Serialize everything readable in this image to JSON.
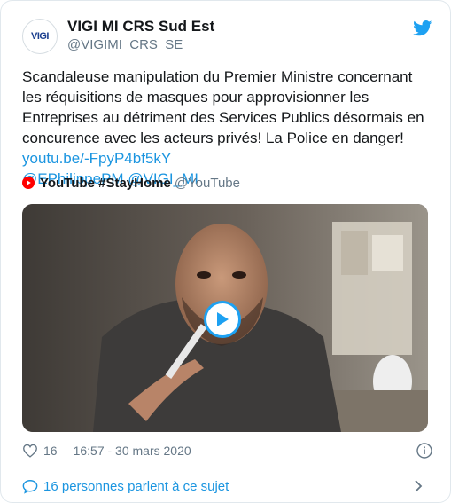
{
  "tweet": {
    "author_name": "VIGI MI CRS Sud Est",
    "author_handle": "@VIGIMI_CRS_SE",
    "avatar_text": "VIGI",
    "text": "Scandaleuse manipulation du Premier Ministre concernant les réquisitions de masques pour approvisionner les Entreprises au détriment des Services Publics désormais en concurence avec les acteurs privés! La Police en danger! ",
    "link": "youtu.be/-FpyP4bf5kY",
    "mentions": [
      "@EPhilippePM",
      "@VIGI_MI"
    ],
    "likes": "16",
    "timestamp": "16:57 - 30 mars 2020",
    "conversation": "16 personnes parlent à ce sujet"
  },
  "source": {
    "title": "YouTube #StayHome",
    "handle": "@YouTube"
  },
  "icons": {
    "platform": "twitter-bird-icon",
    "source": "youtube-icon",
    "play": "play-icon",
    "like": "heart-icon",
    "info": "info-icon",
    "conversation": "speech-bubble-icon",
    "more": "chevron-right-icon"
  },
  "colors": {
    "link": "#1b95e0",
    "text": "#14171a",
    "muted": "#657786",
    "twitter_blue": "#1da1f2",
    "youtube_red": "#ff0000"
  }
}
